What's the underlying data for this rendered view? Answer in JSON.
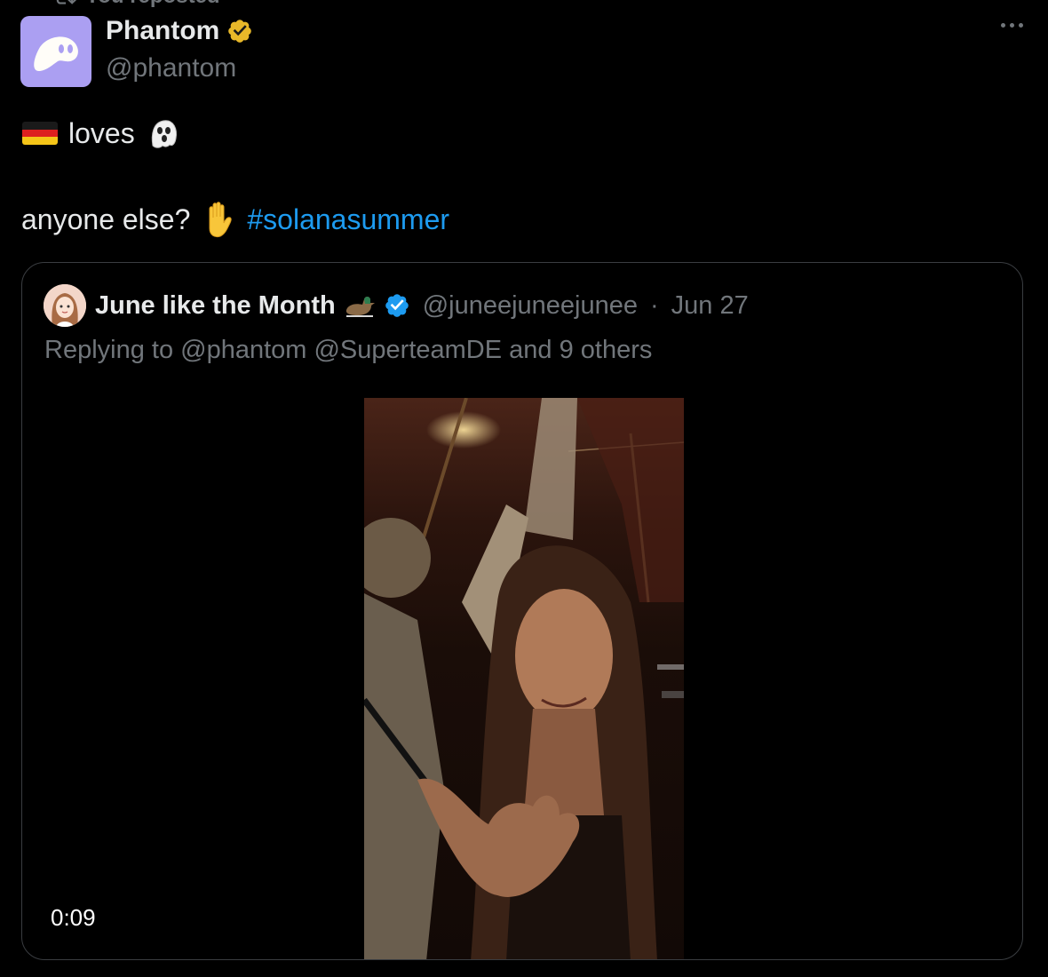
{
  "repost": {
    "label": "You reposted"
  },
  "post": {
    "display_name": "Phantom",
    "handle": "@phantom",
    "line1_word": "loves",
    "line2_text": "anyone else?",
    "hashtag": "#solanasummer"
  },
  "quoted": {
    "display_name": "June like the Month",
    "handle": "@juneejuneejunee",
    "separator": "·",
    "date": "Jun 27",
    "replying": "Replying to @phantom @SuperteamDE and 9 others",
    "video_duration": "0:09"
  },
  "icons": {
    "repost": "repost-icon",
    "verified_gold": "gold-verified-badge-icon",
    "verified_blue": "blue-verified-badge-icon",
    "more": "more-options-icon",
    "flag": "germany-flag-icon",
    "ghost": "ghost-icon",
    "hand": "raised-hand-icon",
    "duck": "duck-icon"
  },
  "colors": {
    "background": "#000000",
    "text": "#e7e9ea",
    "muted": "#71767b",
    "link": "#1d9bf0",
    "phantom_brand": "#ab9ff2",
    "gold_badge": "#e8b829",
    "blue_badge": "#1d9bf0"
  }
}
